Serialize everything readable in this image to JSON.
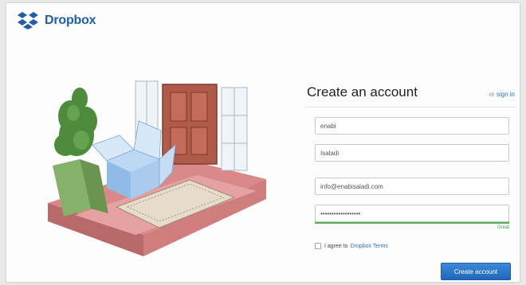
{
  "brand": {
    "name": "Dropbox"
  },
  "form": {
    "title": "Create an account",
    "signin_prefix": "or",
    "signin_link": "sign in",
    "first_name": "enabi",
    "last_name": "Isaladi",
    "email": "info@enabisaladi.com",
    "password": "••••••••••••••••••",
    "password_strength": "Great",
    "terms_prefix": "I agree to",
    "terms_link": "Dropbox Terms",
    "submit_label": "Create account"
  },
  "colors": {
    "brand": "#1f5fa8",
    "link": "#2a74c9",
    "strength": "#4fb34f",
    "button": "#1f67ba"
  },
  "icons": {
    "logo": "dropbox-logo-icon",
    "illustration": "front-door-welcome-illustration"
  }
}
